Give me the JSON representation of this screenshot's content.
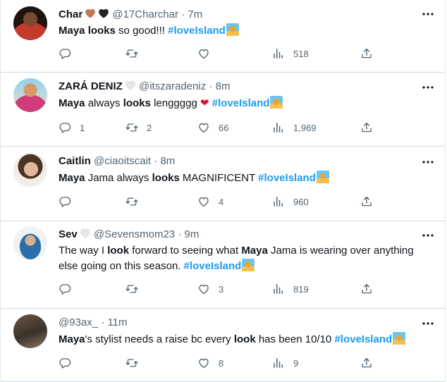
{
  "tweets": [
    {
      "name": "Char",
      "hearts": [
        "#c07a55",
        "#222222"
      ],
      "handle": "@17Charchar",
      "dot": "·",
      "time": "7m",
      "body": [
        {
          "t": "Maya",
          "s": "b"
        },
        {
          "t": " "
        },
        {
          "t": "looks",
          "s": "b"
        },
        {
          "t": " so good!!! "
        },
        {
          "t": "#loveIsland",
          "s": "tag"
        }
      ],
      "replies": "",
      "retweets": "",
      "likes": "",
      "views": "518"
    },
    {
      "name": "ZARÁ DENIZ",
      "hearts": [
        "#e6e6e6"
      ],
      "handle": "@itszaradeniz",
      "dot": "·",
      "time": "8m",
      "body": [
        {
          "t": "Maya",
          "s": "b"
        },
        {
          "t": " always "
        },
        {
          "t": "looks",
          "s": "b"
        },
        {
          "t": " lenggggg "
        },
        {
          "t": "❤",
          "s": "red"
        },
        {
          "t": " "
        },
        {
          "t": "#loveIsland",
          "s": "tag"
        }
      ],
      "replies": "1",
      "retweets": "2",
      "likes": "66",
      "views": "1,969"
    },
    {
      "name": "Caitlin",
      "hearts": [],
      "handle": "@ciaoitscait",
      "dot": "·",
      "time": "8m",
      "body": [
        {
          "t": "Maya",
          "s": "b"
        },
        {
          "t": " Jama always "
        },
        {
          "t": "looks",
          "s": "b"
        },
        {
          "t": " MAGNIFICENT "
        },
        {
          "t": "#loveIsland",
          "s": "tag"
        }
      ],
      "replies": "",
      "retweets": "",
      "likes": "4",
      "views": "960"
    },
    {
      "name": "Sev",
      "hearts": [
        "#e6e6e6"
      ],
      "handle": "@Sevensmom23",
      "dot": "·",
      "time": "9m",
      "body": [
        {
          "t": "The way I "
        },
        {
          "t": "look",
          "s": "b"
        },
        {
          "t": " forward to seeing what "
        },
        {
          "t": "Maya",
          "s": "b"
        },
        {
          "t": " Jama is wearing over anything else going on this season. "
        },
        {
          "t": "#loveIsland",
          "s": "tag"
        }
      ],
      "replies": "",
      "retweets": "",
      "likes": "3",
      "views": "819"
    },
    {
      "name": "",
      "hearts": [],
      "handle": "@93ax_",
      "dot": "·",
      "time": "11m",
      "body": [
        {
          "t": "Maya",
          "s": "b"
        },
        {
          "t": "'s stylist needs a raise bc every "
        },
        {
          "t": "look",
          "s": "b"
        },
        {
          "t": " has been 10/10 "
        },
        {
          "t": "#loveIsland",
          "s": "tag"
        }
      ],
      "replies": "",
      "retweets": "",
      "likes": "8",
      "views": "9"
    }
  ],
  "icons": {
    "reply": "reply-icon",
    "retweet": "retweet-icon",
    "like": "like-icon",
    "views": "views-icon",
    "share": "share-icon",
    "more": "more-icon",
    "hashtag_emoji": "love-island-emoji"
  },
  "colors": {
    "hashtag": "#1d9bf0",
    "muted": "#536471",
    "divider": "#cfd9de",
    "red_heart": "#d0142c"
  }
}
